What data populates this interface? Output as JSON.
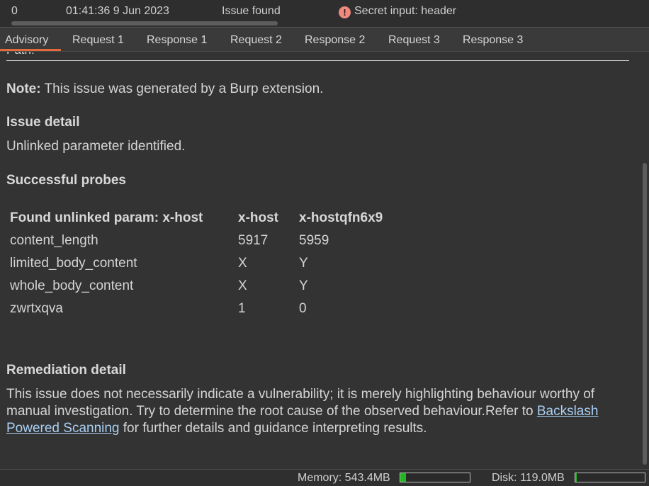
{
  "issue_row": {
    "index": "0",
    "time": "01:41:36 9 Jun 2023",
    "action": "Issue found",
    "issue_icon": "warning-circle-icon",
    "issue_name": "Secret input: header"
  },
  "tabs": [
    {
      "label": "Advisory",
      "active": true
    },
    {
      "label": "Request 1"
    },
    {
      "label": "Response 1"
    },
    {
      "label": "Request 2"
    },
    {
      "label": "Response 2"
    },
    {
      "label": "Request 3"
    },
    {
      "label": "Response 3"
    }
  ],
  "advisory": {
    "path_label_partial": "Path:",
    "note_label": "Note:",
    "note_text": " This issue was generated by a Burp extension.",
    "issue_detail_heading": "Issue detail",
    "issue_detail_text": "Unlinked parameter identified.",
    "probes_heading": "Successful probes",
    "probes_table": {
      "headers": [
        "Found unlinked param: x-host",
        "x-host",
        "x-hostqfn6x9"
      ],
      "rows": [
        [
          "content_length",
          "5917",
          "5959"
        ],
        [
          "limited_body_content",
          "X",
          "Y"
        ],
        [
          "whole_body_content",
          "X",
          "Y"
        ],
        [
          "zwrtxqva",
          "1",
          "0"
        ]
      ]
    },
    "remediation_heading": "Remediation detail",
    "remediation_text_before": "This issue does not necessarily indicate a vulnerability; it is merely highlighting behaviour worthy of manual investigation. Try to determine the root cause of the observed behaviour.Refer to ",
    "remediation_link": "Backslash Powered Scanning",
    "remediation_text_after": " for further details and guidance interpreting results."
  },
  "status_bar": {
    "memory_label": "Memory: 543.4MB",
    "memory_fraction": 0.08,
    "disk_label": "Disk: 119.0MB",
    "disk_fraction": 0.02
  },
  "colors": {
    "background": "#323232",
    "tab_active_underline": "#e36b3b",
    "link": "#a9cff2",
    "meter_fill": "#22b622",
    "issue_icon": "#f08a7e"
  }
}
